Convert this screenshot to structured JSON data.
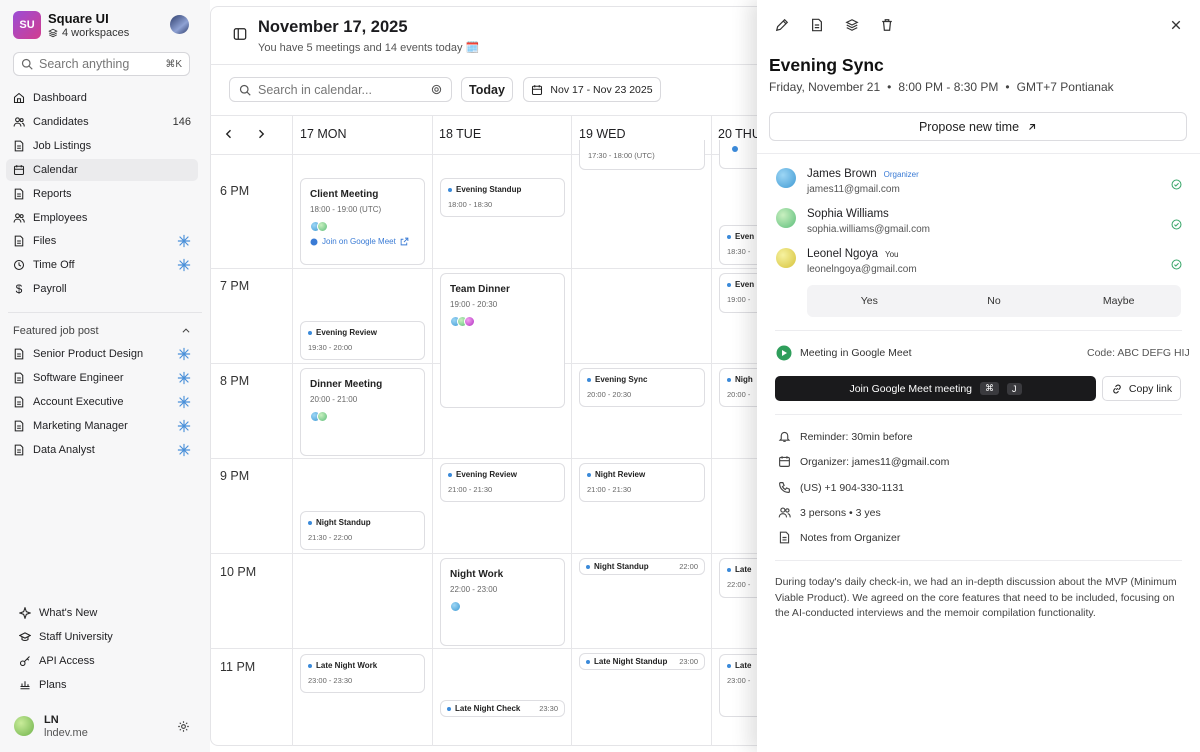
{
  "sidebar": {
    "logo": "SU",
    "app_name": "Square UI",
    "workspaces": "4 workspaces",
    "search_placeholder": "Search anything",
    "search_shortcut": "⌘K",
    "nav": [
      {
        "label": "Dashboard",
        "icon": "home-icon"
      },
      {
        "label": "Candidates",
        "icon": "users-icon",
        "count": "146"
      },
      {
        "label": "Job Listings",
        "icon": "document-icon"
      },
      {
        "label": "Calendar",
        "icon": "calendar-icon",
        "active": true
      },
      {
        "label": "Reports",
        "icon": "document-icon"
      },
      {
        "label": "Employees",
        "icon": "users-icon"
      },
      {
        "label": "Files",
        "icon": "document-icon"
      },
      {
        "label": "Time Off",
        "icon": "clock-icon"
      },
      {
        "label": "Payroll",
        "icon": "dollar-icon"
      }
    ],
    "featured_title": "Featured job post",
    "featured": [
      "Senior Product Design",
      "Software Engineer",
      "Account Executive",
      "Marketing Manager",
      "Data Analyst"
    ],
    "bottom": [
      {
        "label": "What's New",
        "icon": "sparkle-icon"
      },
      {
        "label": "Staff University",
        "icon": "graduation-icon"
      },
      {
        "label": "API Access",
        "icon": "key-icon"
      },
      {
        "label": "Plans",
        "icon": "plans-icon"
      }
    ],
    "user_initials": "LN",
    "user_sub": "lndev.me"
  },
  "header": {
    "date_title": "November 17, 2025",
    "subtitle": "You have 5 meetings and 14 events today 🗓️",
    "search_placeholder": "Search in calendar...",
    "today_label": "Today",
    "range_label": "Nov 17 - Nov 23 2025"
  },
  "calendar": {
    "days": [
      "17 MON",
      "18 TUE",
      "19 WED",
      "20 THU"
    ],
    "hours": [
      "6 PM",
      "7 PM",
      "8 PM",
      "9 PM",
      "10 PM",
      "11 PM"
    ],
    "events": {
      "wed_top_time": "17:30 - 18:00 (UTC)",
      "client_meeting": {
        "name": "Client Meeting",
        "time": "18:00 - 19:00 (UTC)",
        "meet": "Join on Google Meet"
      },
      "evening_standup": {
        "name": "Evening Standup",
        "time": "18:00 - 18:30"
      },
      "team_dinner": {
        "name": "Team Dinner",
        "time": "19:00 - 20:30"
      },
      "evening_review_mon": {
        "name": "Evening Review",
        "time": "19:30 - 20:00"
      },
      "dinner_meeting": {
        "name": "Dinner Meeting",
        "time": "20:00 - 21:00"
      },
      "evening_sync_wed": {
        "name": "Evening Sync",
        "time": "20:00 - 20:30"
      },
      "evening_review_tue": {
        "name": "Evening Review",
        "time": "21:00 - 21:30"
      },
      "night_review_wed": {
        "name": "Night Review",
        "time": "21:00 - 21:30"
      },
      "night_standup_mon": {
        "name": "Night Standup",
        "time": "21:30 - 22:00"
      },
      "night_work": {
        "name": "Night Work",
        "time": "22:00 - 23:00"
      },
      "night_standup_wed": {
        "name": "Night Standup",
        "time": "22:00"
      },
      "late_night_work": {
        "name": "Late Night Work",
        "time": "23:00 - 23:30"
      },
      "late_night_standup": {
        "name": "Late Night Standup",
        "time": "23:00"
      },
      "late_night_check": {
        "name": "Late Night Check",
        "time": "23:30"
      },
      "thu_evening_1": {
        "name": "Even",
        "time": "18:30 -"
      },
      "thu_evening_2": {
        "name": "Even",
        "time": "19:00 -"
      },
      "thu_night": {
        "name": "Nigh",
        "time": "20:00 -"
      },
      "thu_late_1": {
        "name": "Late",
        "time": "22:00 -"
      },
      "thu_late_2": {
        "name": "Late",
        "time": "23:00 -"
      }
    }
  },
  "panel": {
    "title": "Evening Sync",
    "day": "Friday, November 21",
    "time": "8:00 PM - 8:30 PM",
    "tz": "GMT+7 Pontianak",
    "propose": "Propose new time",
    "attendees": [
      {
        "name": "James Brown",
        "email": "james11@gmail.com",
        "tag": "Organizer"
      },
      {
        "name": "Sophia Williams",
        "email": "sophia.williams@gmail.com",
        "tag": ""
      },
      {
        "name": "Leonel Ngoya",
        "email": "leonelngoya@gmail.com",
        "tag": "You"
      }
    ],
    "rsvp": [
      "Yes",
      "No",
      "Maybe"
    ],
    "meet_label": "Meeting in Google Meet",
    "meet_code": "Code: ABC DEFG HIJ",
    "join_label": "Join Google Meet meeting",
    "join_keys": [
      "⌘",
      "J"
    ],
    "copy_label": "Copy link",
    "details": [
      {
        "icon": "bell-icon",
        "text": "Reminder: 30min before"
      },
      {
        "icon": "calendar-icon",
        "text": "Organizer: james11@gmail.com"
      },
      {
        "icon": "phone-icon",
        "text": "(US) +1 904-330-1131"
      },
      {
        "icon": "users-icon",
        "text": "3 persons  •  3 yes"
      },
      {
        "icon": "document-icon",
        "text": "Notes from Organizer"
      }
    ],
    "notes": "During today's daily check-in, we had an in-depth discussion about the MVP (Minimum Viable Product). We agreed on the core features that need to be included, focusing on the AI-conducted interviews and the memoir compilation functionality."
  }
}
